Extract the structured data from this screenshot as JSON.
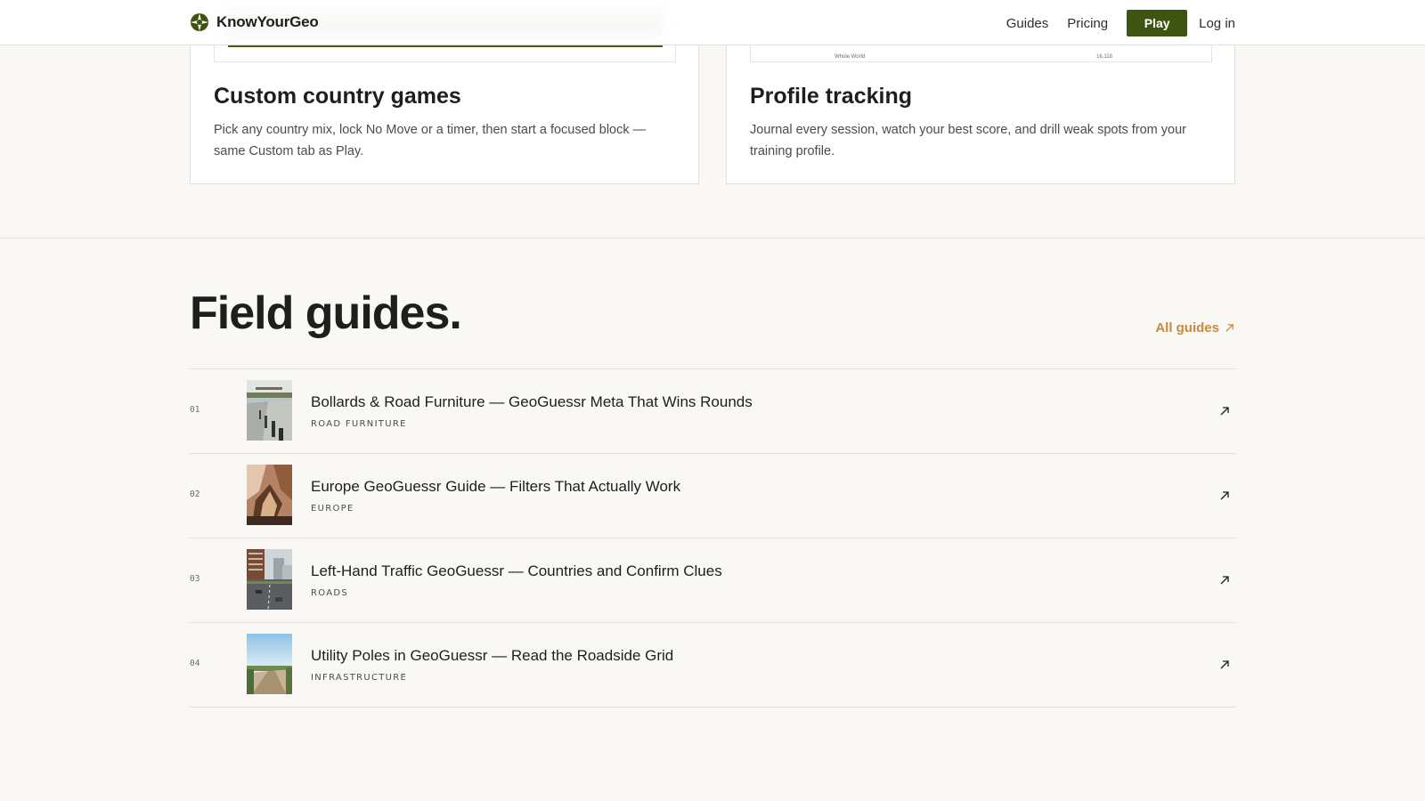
{
  "header": {
    "brand_name": "KnowYourGeo",
    "nav": {
      "guides": "Guides",
      "pricing": "Pricing",
      "play": "Play",
      "login": "Log in"
    }
  },
  "features": [
    {
      "media_labels": {
        "left": "",
        "right": ""
      },
      "title": "Custom country games",
      "description": "Pick any country mix, lock No Move or a timer, then start a focused block — same Custom tab as Play."
    },
    {
      "media_labels": {
        "left": "Whole World",
        "right": "16,118"
      },
      "title": "Profile tracking",
      "description": "Journal every session, watch your best score, and drill weak spots from your training profile."
    }
  ],
  "guides_section": {
    "title": "Field guides.",
    "all_link": "All guides",
    "items": [
      {
        "num": "01",
        "title": "Bollards & Road Furniture — GeoGuessr Meta That Wins Rounds",
        "category": "ROAD FURNITURE"
      },
      {
        "num": "02",
        "title": "Europe GeoGuessr Guide — Filters That Actually Work",
        "category": "EUROPE"
      },
      {
        "num": "03",
        "title": "Left-Hand Traffic GeoGuessr — Countries and Confirm Clues",
        "category": "ROADS"
      },
      {
        "num": "04",
        "title": "Utility Poles in GeoGuessr — Read the Roadside Grid",
        "category": "INFRASTRUCTURE"
      }
    ]
  },
  "colors": {
    "accent": "#3d5510",
    "link": "#c88a3c",
    "background": "#f9f8f5",
    "card": "#ffffff"
  }
}
